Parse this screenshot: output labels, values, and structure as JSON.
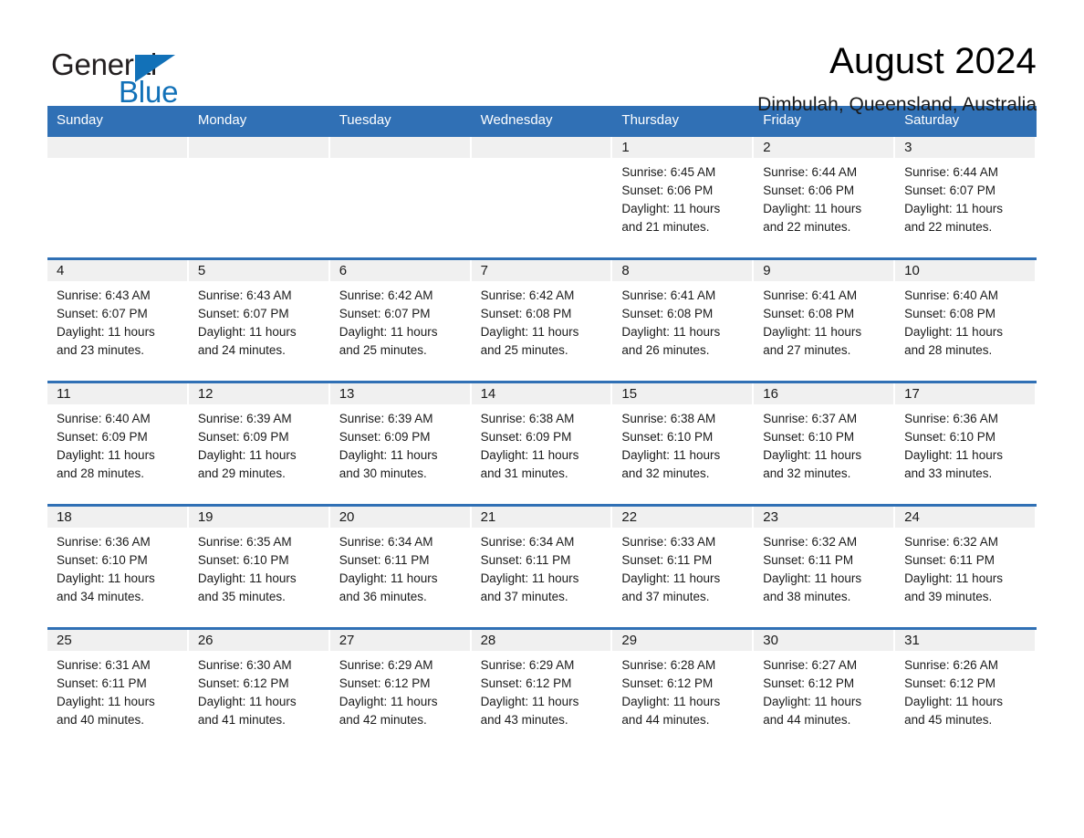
{
  "logo": {
    "word_black": "General",
    "word_blue": "Blue",
    "triangle": "triangle-mark",
    "brand_blue": "#1271b8"
  },
  "header": {
    "title": "August 2024",
    "location": "Dimbulah, Queensland, Australia"
  },
  "colors": {
    "header_blue": "#3070b5",
    "date_strip_gray": "#f0f0f0",
    "text": "#1a1a1a"
  },
  "weekdays": [
    "Sunday",
    "Monday",
    "Tuesday",
    "Wednesday",
    "Thursday",
    "Friday",
    "Saturday"
  ],
  "weeks": [
    [
      {
        "day": "",
        "sunrise": "",
        "sunset": "",
        "daylight1": "",
        "daylight2": ""
      },
      {
        "day": "",
        "sunrise": "",
        "sunset": "",
        "daylight1": "",
        "daylight2": ""
      },
      {
        "day": "",
        "sunrise": "",
        "sunset": "",
        "daylight1": "",
        "daylight2": ""
      },
      {
        "day": "",
        "sunrise": "",
        "sunset": "",
        "daylight1": "",
        "daylight2": ""
      },
      {
        "day": "1",
        "sunrise": "Sunrise: 6:45 AM",
        "sunset": "Sunset: 6:06 PM",
        "daylight1": "Daylight: 11 hours",
        "daylight2": "and 21 minutes."
      },
      {
        "day": "2",
        "sunrise": "Sunrise: 6:44 AM",
        "sunset": "Sunset: 6:06 PM",
        "daylight1": "Daylight: 11 hours",
        "daylight2": "and 22 minutes."
      },
      {
        "day": "3",
        "sunrise": "Sunrise: 6:44 AM",
        "sunset": "Sunset: 6:07 PM",
        "daylight1": "Daylight: 11 hours",
        "daylight2": "and 22 minutes."
      }
    ],
    [
      {
        "day": "4",
        "sunrise": "Sunrise: 6:43 AM",
        "sunset": "Sunset: 6:07 PM",
        "daylight1": "Daylight: 11 hours",
        "daylight2": "and 23 minutes."
      },
      {
        "day": "5",
        "sunrise": "Sunrise: 6:43 AM",
        "sunset": "Sunset: 6:07 PM",
        "daylight1": "Daylight: 11 hours",
        "daylight2": "and 24 minutes."
      },
      {
        "day": "6",
        "sunrise": "Sunrise: 6:42 AM",
        "sunset": "Sunset: 6:07 PM",
        "daylight1": "Daylight: 11 hours",
        "daylight2": "and 25 minutes."
      },
      {
        "day": "7",
        "sunrise": "Sunrise: 6:42 AM",
        "sunset": "Sunset: 6:08 PM",
        "daylight1": "Daylight: 11 hours",
        "daylight2": "and 25 minutes."
      },
      {
        "day": "8",
        "sunrise": "Sunrise: 6:41 AM",
        "sunset": "Sunset: 6:08 PM",
        "daylight1": "Daylight: 11 hours",
        "daylight2": "and 26 minutes."
      },
      {
        "day": "9",
        "sunrise": "Sunrise: 6:41 AM",
        "sunset": "Sunset: 6:08 PM",
        "daylight1": "Daylight: 11 hours",
        "daylight2": "and 27 minutes."
      },
      {
        "day": "10",
        "sunrise": "Sunrise: 6:40 AM",
        "sunset": "Sunset: 6:08 PM",
        "daylight1": "Daylight: 11 hours",
        "daylight2": "and 28 minutes."
      }
    ],
    [
      {
        "day": "11",
        "sunrise": "Sunrise: 6:40 AM",
        "sunset": "Sunset: 6:09 PM",
        "daylight1": "Daylight: 11 hours",
        "daylight2": "and 28 minutes."
      },
      {
        "day": "12",
        "sunrise": "Sunrise: 6:39 AM",
        "sunset": "Sunset: 6:09 PM",
        "daylight1": "Daylight: 11 hours",
        "daylight2": "and 29 minutes."
      },
      {
        "day": "13",
        "sunrise": "Sunrise: 6:39 AM",
        "sunset": "Sunset: 6:09 PM",
        "daylight1": "Daylight: 11 hours",
        "daylight2": "and 30 minutes."
      },
      {
        "day": "14",
        "sunrise": "Sunrise: 6:38 AM",
        "sunset": "Sunset: 6:09 PM",
        "daylight1": "Daylight: 11 hours",
        "daylight2": "and 31 minutes."
      },
      {
        "day": "15",
        "sunrise": "Sunrise: 6:38 AM",
        "sunset": "Sunset: 6:10 PM",
        "daylight1": "Daylight: 11 hours",
        "daylight2": "and 32 minutes."
      },
      {
        "day": "16",
        "sunrise": "Sunrise: 6:37 AM",
        "sunset": "Sunset: 6:10 PM",
        "daylight1": "Daylight: 11 hours",
        "daylight2": "and 32 minutes."
      },
      {
        "day": "17",
        "sunrise": "Sunrise: 6:36 AM",
        "sunset": "Sunset: 6:10 PM",
        "daylight1": "Daylight: 11 hours",
        "daylight2": "and 33 minutes."
      }
    ],
    [
      {
        "day": "18",
        "sunrise": "Sunrise: 6:36 AM",
        "sunset": "Sunset: 6:10 PM",
        "daylight1": "Daylight: 11 hours",
        "daylight2": "and 34 minutes."
      },
      {
        "day": "19",
        "sunrise": "Sunrise: 6:35 AM",
        "sunset": "Sunset: 6:10 PM",
        "daylight1": "Daylight: 11 hours",
        "daylight2": "and 35 minutes."
      },
      {
        "day": "20",
        "sunrise": "Sunrise: 6:34 AM",
        "sunset": "Sunset: 6:11 PM",
        "daylight1": "Daylight: 11 hours",
        "daylight2": "and 36 minutes."
      },
      {
        "day": "21",
        "sunrise": "Sunrise: 6:34 AM",
        "sunset": "Sunset: 6:11 PM",
        "daylight1": "Daylight: 11 hours",
        "daylight2": "and 37 minutes."
      },
      {
        "day": "22",
        "sunrise": "Sunrise: 6:33 AM",
        "sunset": "Sunset: 6:11 PM",
        "daylight1": "Daylight: 11 hours",
        "daylight2": "and 37 minutes."
      },
      {
        "day": "23",
        "sunrise": "Sunrise: 6:32 AM",
        "sunset": "Sunset: 6:11 PM",
        "daylight1": "Daylight: 11 hours",
        "daylight2": "and 38 minutes."
      },
      {
        "day": "24",
        "sunrise": "Sunrise: 6:32 AM",
        "sunset": "Sunset: 6:11 PM",
        "daylight1": "Daylight: 11 hours",
        "daylight2": "and 39 minutes."
      }
    ],
    [
      {
        "day": "25",
        "sunrise": "Sunrise: 6:31 AM",
        "sunset": "Sunset: 6:11 PM",
        "daylight1": "Daylight: 11 hours",
        "daylight2": "and 40 minutes."
      },
      {
        "day": "26",
        "sunrise": "Sunrise: 6:30 AM",
        "sunset": "Sunset: 6:12 PM",
        "daylight1": "Daylight: 11 hours",
        "daylight2": "and 41 minutes."
      },
      {
        "day": "27",
        "sunrise": "Sunrise: 6:29 AM",
        "sunset": "Sunset: 6:12 PM",
        "daylight1": "Daylight: 11 hours",
        "daylight2": "and 42 minutes."
      },
      {
        "day": "28",
        "sunrise": "Sunrise: 6:29 AM",
        "sunset": "Sunset: 6:12 PM",
        "daylight1": "Daylight: 11 hours",
        "daylight2": "and 43 minutes."
      },
      {
        "day": "29",
        "sunrise": "Sunrise: 6:28 AM",
        "sunset": "Sunset: 6:12 PM",
        "daylight1": "Daylight: 11 hours",
        "daylight2": "and 44 minutes."
      },
      {
        "day": "30",
        "sunrise": "Sunrise: 6:27 AM",
        "sunset": "Sunset: 6:12 PM",
        "daylight1": "Daylight: 11 hours",
        "daylight2": "and 44 minutes."
      },
      {
        "day": "31",
        "sunrise": "Sunrise: 6:26 AM",
        "sunset": "Sunset: 6:12 PM",
        "daylight1": "Daylight: 11 hours",
        "daylight2": "and 45 minutes."
      }
    ]
  ]
}
